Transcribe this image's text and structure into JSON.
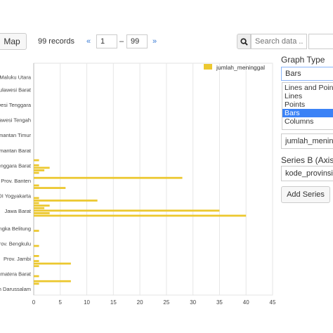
{
  "toolbar": {
    "map_label": "Map",
    "records_label": "99 records",
    "prev_label": "«",
    "next_label": "»",
    "range_from": "1",
    "range_sep": "–",
    "range_to": "99",
    "search_placeholder": "Search data ...",
    "search_icon": "search-icon"
  },
  "sidebar": {
    "graph_type_label": "Graph Type",
    "graph_type_selected": "Bars",
    "graph_type_options": [
      "Lines and Points",
      "Lines",
      "Points",
      "Bars",
      "Columns"
    ],
    "graph_type_selected_index": 3,
    "series_field_value": "jumlah_meninggal",
    "series_b_label": "Series B (Axis ...",
    "series_b_value": "kode_provinsi",
    "add_series_label": "Add Series"
  },
  "colors": {
    "bar": "#ecc830",
    "link": "#3a7bd5",
    "selection": "#3b82f6"
  },
  "chart_data": {
    "type": "bar",
    "orientation": "horizontal",
    "legend": [
      "jumlah_meninggal"
    ],
    "legend_position": "top-right",
    "xlim": [
      0,
      45
    ],
    "x_ticks": [
      0,
      5,
      10,
      15,
      20,
      25,
      30,
      35,
      40,
      45
    ],
    "y_tick_labels": [
      {
        "label": "Maluku Utara",
        "row": 5
      },
      {
        "label": "Sulawesi Barat",
        "row": 10
      },
      {
        "label": "Sulawesi Tenggara",
        "row": 16
      },
      {
        "label": "Sulawesi Tengah",
        "row": 22
      },
      {
        "label": "Kalimantan Timur",
        "row": 28
      },
      {
        "label": "Kalimantan Barat",
        "row": 34
      },
      {
        "label": "Nusa Tenggara Barat",
        "row": 40
      },
      {
        "label": "Prov. Banten",
        "row": 46
      },
      {
        "label": "DI Yogyakarta",
        "row": 52
      },
      {
        "label": "Jawa Barat",
        "row": 58
      },
      {
        "label": "Bangka Belitung",
        "row": 65
      },
      {
        "label": "Prov. Bengkulu",
        "row": 71
      },
      {
        "label": "Prov. Jambi",
        "row": 77
      },
      {
        "label": "Sumatera Barat",
        "row": 83
      },
      {
        "label": "Aceh Darussalam",
        "row": 89
      }
    ],
    "rows": 92,
    "values": [
      0,
      0,
      0,
      0,
      0,
      0,
      0,
      0,
      0,
      0,
      0,
      0,
      0,
      0,
      0,
      0,
      0,
      0,
      0,
      0,
      0,
      0,
      0,
      0,
      0,
      0,
      0,
      0,
      0,
      0,
      0,
      0,
      0,
      0,
      0,
      0,
      0,
      0,
      0,
      0,
      1,
      0,
      0,
      0,
      0,
      0,
      0,
      0,
      0,
      0,
      0,
      0,
      0,
      0,
      0,
      0,
      0,
      0,
      0,
      0,
      0,
      1,
      0,
      1,
      3,
      2,
      1,
      0,
      28,
      0,
      0,
      1,
      6,
      0,
      0,
      0,
      1,
      12,
      1,
      3,
      2,
      35,
      3,
      40,
      0,
      0,
      0,
      0,
      0,
      0,
      0,
      0
    ],
    "values_detail": [
      {
        "row": 38,
        "value": 1
      },
      {
        "row": 40,
        "value": 1
      },
      {
        "row": 41,
        "value": 3
      },
      {
        "row": 42,
        "value": 2
      },
      {
        "row": 43,
        "value": 1
      },
      {
        "row": 45,
        "value": 28
      },
      {
        "row": 48,
        "value": 1
      },
      {
        "row": 49,
        "value": 6
      },
      {
        "row": 53,
        "value": 1
      },
      {
        "row": 54,
        "value": 12
      },
      {
        "row": 55,
        "value": 1
      },
      {
        "row": 56,
        "value": 3
      },
      {
        "row": 57,
        "value": 2
      },
      {
        "row": 58,
        "value": 35
      },
      {
        "row": 59,
        "value": 3
      },
      {
        "row": 60,
        "value": 40
      },
      {
        "row": 66,
        "value": 1
      },
      {
        "row": 72,
        "value": 1
      },
      {
        "row": 76,
        "value": 1
      },
      {
        "row": 78,
        "value": 1
      },
      {
        "row": 79,
        "value": 7
      },
      {
        "row": 80,
        "value": 1
      },
      {
        "row": 84,
        "value": 1
      },
      {
        "row": 86,
        "value": 7
      },
      {
        "row": 87,
        "value": 1
      }
    ],
    "grid": true
  }
}
